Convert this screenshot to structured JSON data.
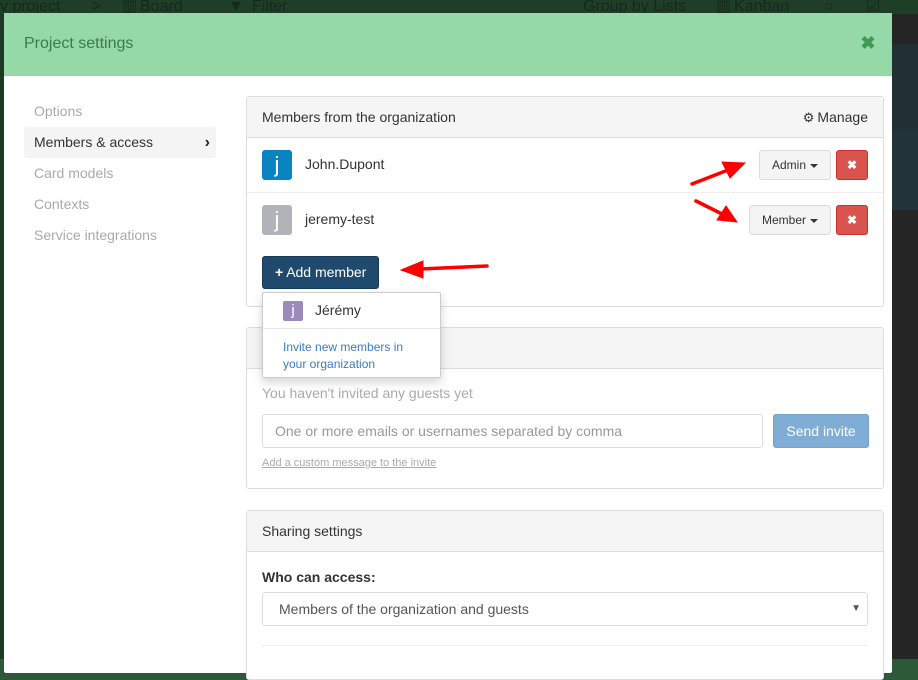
{
  "background_app": {
    "breadcrumb_project": "v project",
    "breadcrumb_separator": ">",
    "board_label": "Board",
    "filter_label": "Filter",
    "group_by_label": "Group by Lists",
    "view_label": "Kanban"
  },
  "modal": {
    "title": "Project settings",
    "close_icon": "close-icon"
  },
  "sidebar": {
    "items": [
      {
        "label": "Options",
        "active": false
      },
      {
        "label": "Members & access",
        "active": true
      },
      {
        "label": "Card models",
        "active": false
      },
      {
        "label": "Contexts",
        "active": false
      },
      {
        "label": "Service integrations",
        "active": false
      }
    ]
  },
  "members_panel": {
    "heading": "Members from the organization",
    "manage_label": "Manage",
    "members": [
      {
        "initial": "j",
        "name": "John.Dupont",
        "role": "Admin",
        "avatar_color": "#0a84c1"
      },
      {
        "initial": "j",
        "name": "jeremy-test",
        "role": "Member",
        "avatar_color": "#b0b3b8"
      }
    ],
    "add_member_label": "Add member"
  },
  "add_member_dropdown": {
    "suggestions": [
      {
        "initial": "j",
        "name": "Jérémy",
        "avatar_color": "#9b8bbd"
      }
    ],
    "invite_link": "Invite new members in your organization"
  },
  "guests_panel": {
    "empty_text": "You haven't invited any guests yet",
    "input_placeholder": "One or more emails or usernames separated by comma",
    "input_value": "",
    "send_label": "Send invite",
    "custom_message_link": "Add a custom message to the invite"
  },
  "sharing_panel": {
    "heading": "Sharing settings",
    "who_label": "Who can access:",
    "access_selected": "Members of the organization and guests"
  },
  "colors": {
    "header_green": "#96d9a8",
    "title_green": "#3a7b4b",
    "danger": "#d9534f",
    "primary_dark": "#1f4a6e",
    "send_invite": "#7fadd5",
    "link": "#3b7bbf",
    "annotation_arrow": "#ff0000"
  }
}
